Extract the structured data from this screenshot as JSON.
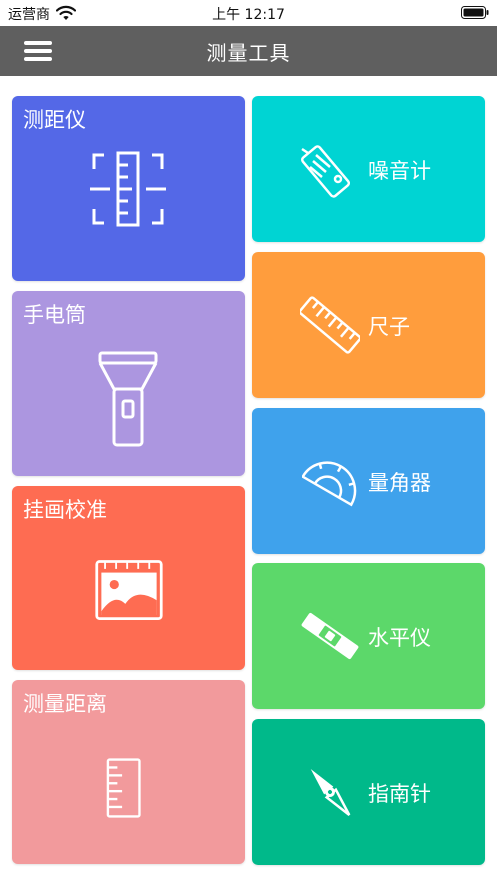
{
  "status_bar": {
    "carrier": "运营商",
    "time": "上午 12:17"
  },
  "nav": {
    "title": "测量工具",
    "menu_icon": "hamburger-menu-icon"
  },
  "tiles": {
    "rangefinder": {
      "label": "测距仪",
      "icon": "rangefinder-icon",
      "color": "#5468e7"
    },
    "flashlight": {
      "label": "手电筒",
      "icon": "flashlight-icon",
      "color": "#ac96e0"
    },
    "picture": {
      "label": "挂画校准",
      "icon": "picture-frame-icon",
      "color": "#fe6c52"
    },
    "distance": {
      "label": "测量距离",
      "icon": "vertical-ruler-icon",
      "color": "#f29a9c"
    },
    "noise": {
      "label": "噪音计",
      "icon": "noise-meter-icon",
      "color": "#00d4d3"
    },
    "ruler": {
      "label": "尺子",
      "icon": "ruler-icon",
      "color": "#ff9d3d"
    },
    "protractor": {
      "label": "量角器",
      "icon": "protractor-icon",
      "color": "#3fa2ec"
    },
    "level": {
      "label": "水平仪",
      "icon": "spirit-level-icon",
      "color": "#5cd86a"
    },
    "compass": {
      "label": "指南针",
      "icon": "compass-icon",
      "color": "#00b98a"
    }
  }
}
